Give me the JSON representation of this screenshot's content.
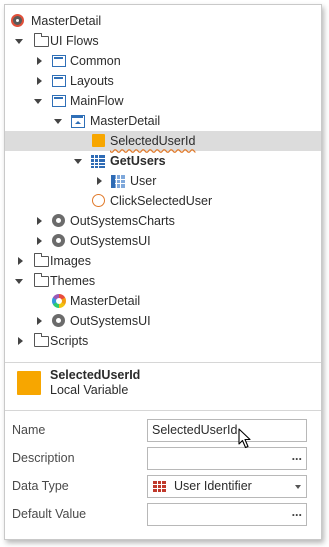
{
  "tree": [
    {
      "label": "MasterDetail",
      "icon": "application-icon",
      "expand": "none",
      "bold": false,
      "squiggle": false,
      "selected": false,
      "name": "tree-item-masterdetail-app",
      "iconX": 6,
      "arrowX": null,
      "labelX": 26
    },
    {
      "label": "UI Flows",
      "icon": "folder-icon",
      "expand": "down",
      "bold": false,
      "squiggle": false,
      "selected": false,
      "name": "tree-item-ui-flows",
      "iconX": 29,
      "arrowX": 10,
      "labelX": 45
    },
    {
      "label": "Common",
      "icon": "flow-icon",
      "expand": "right",
      "bold": false,
      "squiggle": false,
      "selected": false,
      "name": "tree-item-common",
      "iconX": 47,
      "arrowX": 30,
      "labelX": 65
    },
    {
      "label": "Layouts",
      "icon": "flow-icon",
      "expand": "right",
      "bold": false,
      "squiggle": false,
      "selected": false,
      "name": "tree-item-layouts",
      "iconX": 47,
      "arrowX": 30,
      "labelX": 65
    },
    {
      "label": "MainFlow",
      "icon": "flow-icon",
      "expand": "down",
      "bold": false,
      "squiggle": false,
      "selected": false,
      "name": "tree-item-mainflow",
      "iconX": 47,
      "arrowX": 29,
      "labelX": 65
    },
    {
      "label": "MasterDetail",
      "icon": "screen-icon",
      "expand": "down",
      "bold": false,
      "squiggle": false,
      "selected": false,
      "name": "tree-item-masterdetail-screen",
      "iconX": 66,
      "arrowX": 49,
      "labelX": 85
    },
    {
      "label": "SelectedUserId",
      "icon": "local-variable-icon",
      "expand": "none",
      "bold": false,
      "squiggle": true,
      "selected": true,
      "name": "tree-item-selecteduserid",
      "iconX": 87,
      "arrowX": null,
      "labelX": 105
    },
    {
      "label": "GetUsers",
      "icon": "aggregate-icon",
      "expand": "down",
      "bold": true,
      "squiggle": false,
      "selected": false,
      "name": "tree-item-getusers",
      "iconX": 86,
      "arrowX": 69,
      "labelX": 105
    },
    {
      "label": "User",
      "icon": "entity-icon",
      "expand": "right",
      "bold": false,
      "squiggle": false,
      "selected": false,
      "name": "tree-item-user",
      "iconX": 106,
      "arrowX": 90,
      "labelX": 125
    },
    {
      "label": "ClickSelectedUser",
      "icon": "client-action-icon",
      "expand": "none",
      "bold": false,
      "squiggle": false,
      "selected": false,
      "name": "tree-item-clickselecteduser",
      "iconX": 87,
      "arrowX": null,
      "labelX": 105
    },
    {
      "label": "OutSystemsCharts",
      "icon": "module-icon",
      "expand": "right",
      "bold": false,
      "squiggle": false,
      "selected": false,
      "name": "tree-item-outsystemscharts",
      "iconX": 47,
      "arrowX": 30,
      "labelX": 65
    },
    {
      "label": "OutSystemsUI",
      "icon": "module-icon",
      "expand": "right",
      "bold": false,
      "squiggle": false,
      "selected": false,
      "name": "tree-item-outsystemsui",
      "iconX": 47,
      "arrowX": 30,
      "labelX": 65
    },
    {
      "label": "Images",
      "icon": "folder-icon",
      "expand": "right",
      "bold": false,
      "squiggle": false,
      "selected": false,
      "name": "tree-item-images",
      "iconX": 29,
      "arrowX": 11,
      "labelX": 45
    },
    {
      "label": "Themes",
      "icon": "folder-icon",
      "expand": "down",
      "bold": false,
      "squiggle": false,
      "selected": false,
      "name": "tree-item-themes",
      "iconX": 29,
      "arrowX": 10,
      "labelX": 45
    },
    {
      "label": "MasterDetail",
      "icon": "theme-icon",
      "expand": "none",
      "bold": false,
      "squiggle": false,
      "selected": false,
      "name": "tree-item-masterdetail-theme",
      "iconX": 47,
      "arrowX": null,
      "labelX": 65
    },
    {
      "label": "OutSystemsUI",
      "icon": "module-icon",
      "expand": "right",
      "bold": false,
      "squiggle": false,
      "selected": false,
      "name": "tree-item-outsystemsui-theme",
      "iconX": 47,
      "arrowX": 30,
      "labelX": 65
    },
    {
      "label": "Scripts",
      "icon": "folder-icon",
      "expand": "right",
      "bold": false,
      "squiggle": false,
      "selected": false,
      "name": "tree-item-scripts",
      "iconX": 29,
      "arrowX": 11,
      "labelX": 45
    }
  ],
  "selection": {
    "title": "SelectedUserId",
    "subtitle": "Local Variable"
  },
  "properties": {
    "name": {
      "label": "Name",
      "value": "SelectedUserId"
    },
    "description": {
      "label": "Description",
      "value": ""
    },
    "data_type": {
      "label": "Data Type",
      "value": "User Identifier"
    },
    "default_value": {
      "label": "Default Value",
      "value": ""
    }
  },
  "colors": {
    "variable": "#f7a600",
    "selected_row": "#dcdcdc",
    "flow_blue": "#2f6fb7",
    "squiggle": "#e07a2b"
  }
}
